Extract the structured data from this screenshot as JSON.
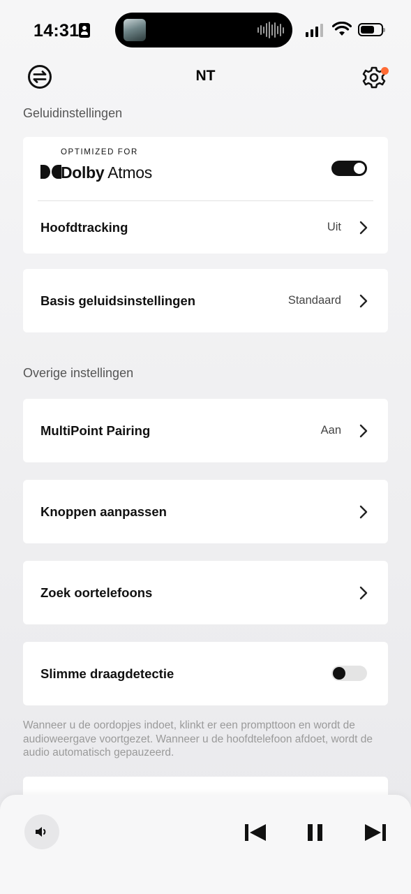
{
  "status_bar": {
    "time": "14:31",
    "icons": [
      "id-card-icon",
      "now-playing-thumbnail",
      "waveform-icon",
      "signal-icon",
      "wifi-icon",
      "battery-icon"
    ]
  },
  "header": {
    "title": "NT",
    "left_icon": "swap-arrows-icon",
    "right_icon": "gear-icon",
    "notification_color": "#ff6b35"
  },
  "sound_section": {
    "label": "Geluidinstellingen",
    "dolby": {
      "small_caption": "OPTIMIZED FOR",
      "brand": "Dolby",
      "product": "Atmos",
      "enabled": true
    },
    "head_tracking": {
      "label": "Hoofdtracking",
      "value": "Uit"
    },
    "basic_sound": {
      "label": "Basis geluidsinstellingen",
      "value": "Standaard"
    }
  },
  "other_section": {
    "label": "Overige instellingen",
    "multipoint": {
      "label": "MultiPoint Pairing",
      "value": "Aan"
    },
    "buttons": {
      "label": "Knoppen aanpassen"
    },
    "find": {
      "label": "Zoek oortelefoons"
    },
    "wear_detection": {
      "label": "Slimme draagdetectie",
      "enabled": false
    },
    "footnote": "Wanneer u de oordopjes indoet, klinkt er een prompttoon en wordt de audioweergave voortgezet. Wanneer u de hoofdtelefoon afdoet, wordt de audio automatisch gepauzeerd."
  },
  "player": {
    "icons": [
      "volume-icon",
      "previous-track-icon",
      "pause-icon",
      "next-track-icon"
    ]
  },
  "colors": {
    "accent": "#ff6b35",
    "toggle_on": "#111111",
    "toggle_off": "#e4e4e4"
  }
}
